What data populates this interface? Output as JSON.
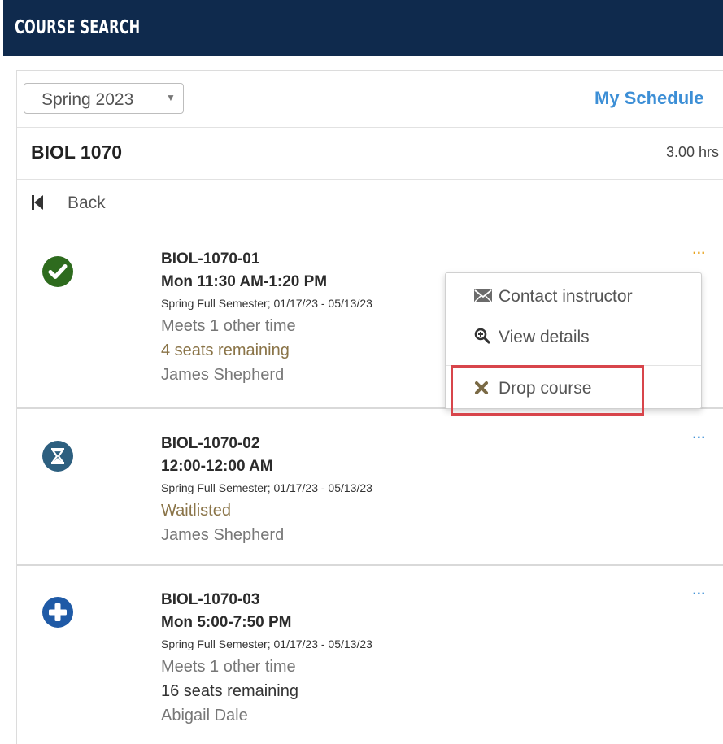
{
  "header": {
    "title": "COURSE SEARCH"
  },
  "toolbar": {
    "term": "Spring 2023",
    "my_schedule": "My Schedule"
  },
  "course": {
    "code": "BIOL 1070",
    "hours": "3.00 hrs"
  },
  "nav": {
    "back": "Back"
  },
  "sections": [
    {
      "id": "BIOL-1070-01",
      "time": "Mon 11:30 AM-1:20 PM",
      "term": "Spring Full Semester; 01/17/23 - 05/13/23",
      "meets": "Meets 1 other time",
      "seats": "4 seats remaining",
      "instructor": "James Shepherd",
      "status": "registered",
      "status_color": "#2e6b1e",
      "more": "..."
    },
    {
      "id": "BIOL-1070-02",
      "time": "12:00-12:00 AM",
      "term": "Spring Full Semester; 01/17/23 - 05/13/23",
      "waitlist": "Waitlisted",
      "instructor": "James Shepherd",
      "status": "waitlisted",
      "status_color": "#2d5f7f",
      "more": "..."
    },
    {
      "id": "BIOL-1070-03",
      "time": "Mon 5:00-7:50 PM",
      "term": "Spring Full Semester; 01/17/23 - 05/13/23",
      "meets": "Meets 1 other time",
      "seats": "16 seats remaining",
      "instructor": "Abigail Dale",
      "status": "available",
      "status_color": "#1f5aa6",
      "more": "..."
    }
  ],
  "context_menu": {
    "items": [
      {
        "label": "Contact instructor",
        "icon": "envelope-icon"
      },
      {
        "label": "View details",
        "icon": "magnifier-icon"
      },
      {
        "label": "Drop course",
        "icon": "x-icon"
      }
    ]
  },
  "colors": {
    "header_bg": "#0f2a4d",
    "link": "#3d8fd6",
    "highlight": "#d8454b",
    "active_dots": "#e8a21b"
  }
}
